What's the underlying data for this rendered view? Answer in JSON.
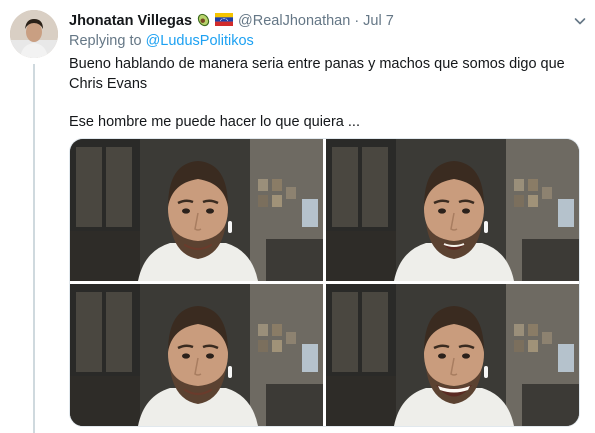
{
  "tweet": {
    "display_name": "Jhonatan Villegas",
    "name_emojis": [
      "avocado-emoji",
      "venezuela-flag-emoji"
    ],
    "handle": "@RealJhonathan",
    "separator": "·",
    "timestamp": "Jul 7",
    "replying_to_label": "Replying to",
    "replying_to_mention": "@LudusPolitikos",
    "text_line_1": "Bueno hablando de manera seria entre panas y machos que somos digo que Chris Evans",
    "text_line_2": "Ese hombre me puede hacer lo que quiera ...",
    "media": [
      {
        "name": "media-photo-1",
        "expression": "closed-smile"
      },
      {
        "name": "media-photo-2",
        "expression": "talking"
      },
      {
        "name": "media-photo-3",
        "expression": "closed-smile"
      },
      {
        "name": "media-photo-4",
        "expression": "big-laugh"
      }
    ]
  },
  "colors": {
    "link": "#1da1f2",
    "secondary_text": "#657786",
    "primary_text": "#14171a",
    "thread_line": "#cfd9de"
  },
  "icons": {
    "menu": "chevron-down-icon"
  }
}
